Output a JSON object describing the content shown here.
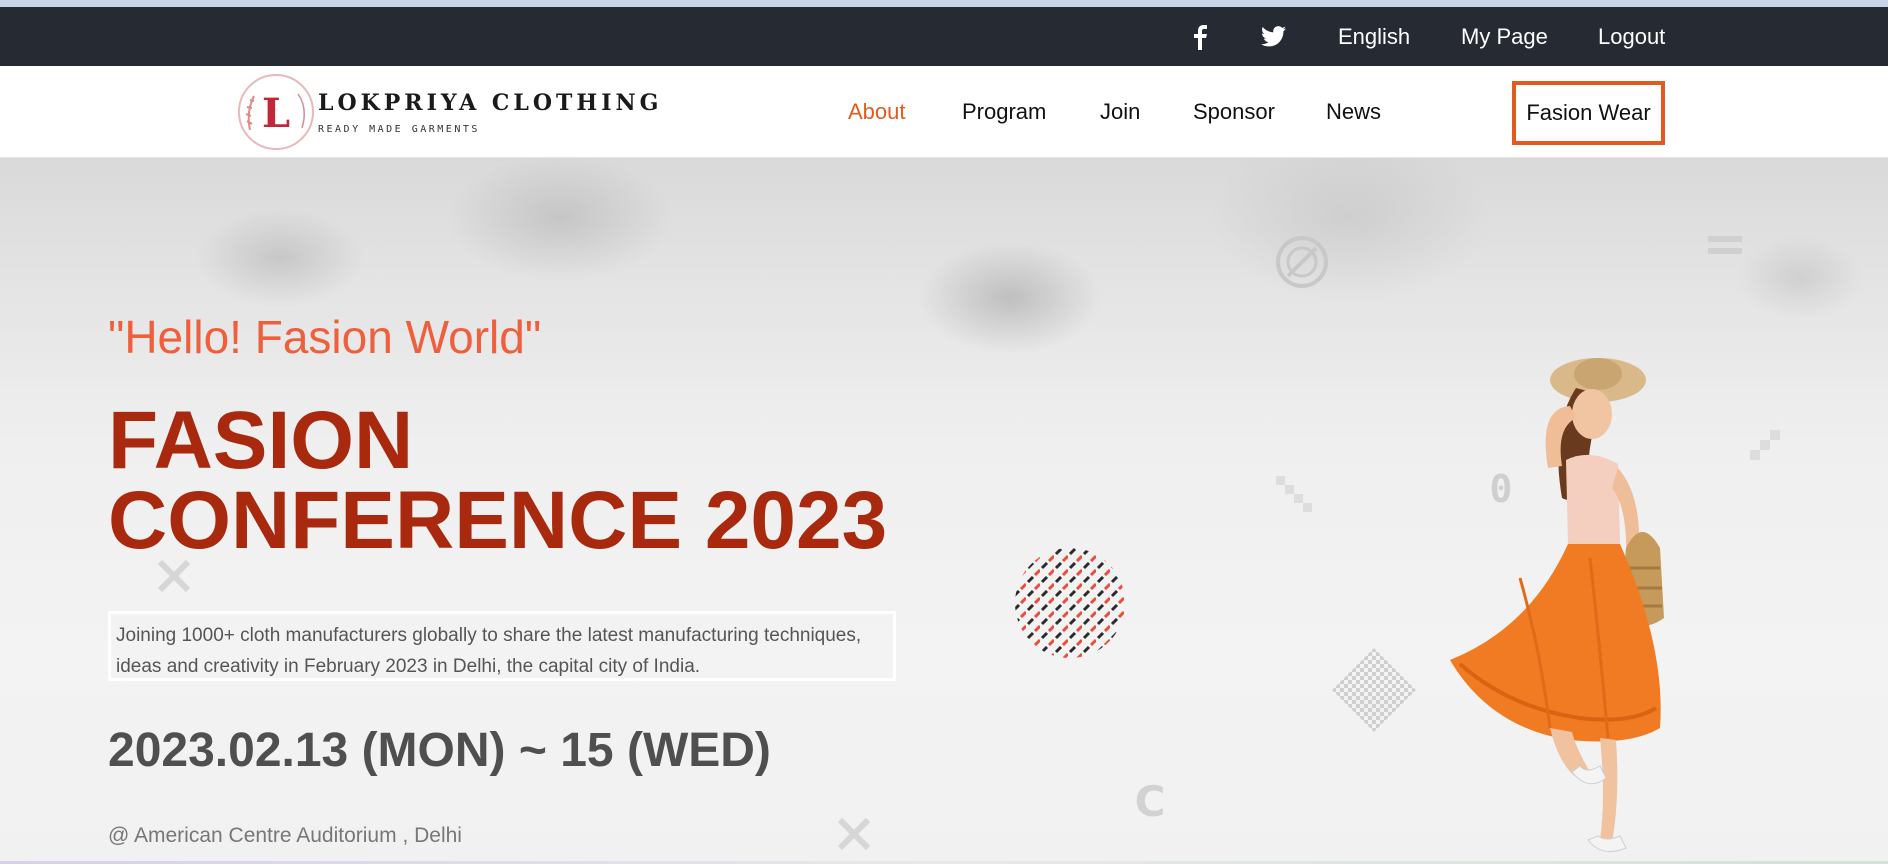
{
  "topbar": {
    "social": [
      {
        "name": "facebook",
        "glyph": "f"
      },
      {
        "name": "twitter",
        "glyph": "🐦"
      }
    ],
    "links": [
      "English",
      "My Page",
      "Logout"
    ]
  },
  "header": {
    "logo": {
      "letter": "L",
      "title": "LOKPRIYA CLOTHING",
      "subtitle": "READY MADE GARMENTS"
    },
    "nav": [
      "About",
      "Program",
      "Join",
      "Sponsor",
      "News"
    ],
    "active_nav": "About",
    "cta": "Fasion Wear"
  },
  "hero": {
    "tagline": "\"Hello! Fasion World\"",
    "title": "FASION CONFERENCE 2023",
    "description": "Joining 1000+ cloth manufacturers globally to share the latest manufacturing techniques, ideas and creativity in February 2023 in Delhi, the capital city of India.",
    "date": "2023.02.13 (MON) ~ 15 (WED)",
    "venue": "@ American Centre Auditorium , Delhi",
    "deco_chars": {
      "zero": "0",
      "c": "C"
    }
  },
  "colors": {
    "accent": "#e35a1f",
    "title": "#a9290f",
    "tagline": "#ef5f3c",
    "topbar_bg": "#252a33"
  }
}
